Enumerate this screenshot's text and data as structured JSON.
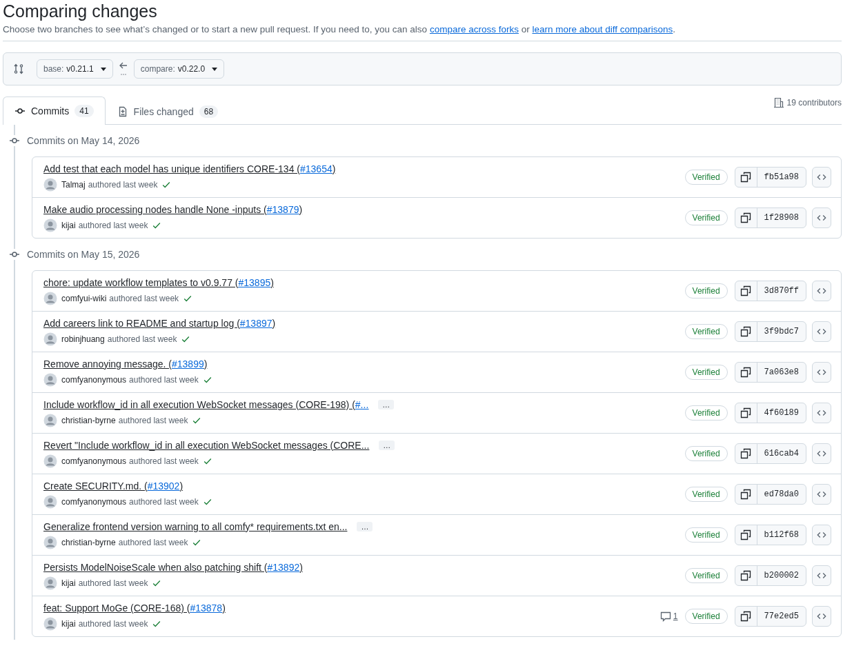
{
  "header": {
    "title": "Comparing changes",
    "description": {
      "text": "Choose two branches to see what’s changed or to start a new pull request. If you need to, you can also ",
      "link1": "compare across forks",
      "middle": " or ",
      "link2": "learn more about diff comparisons",
      "end": "."
    }
  },
  "compare": {
    "base": {
      "label": "base:",
      "value": "v0.21.1"
    },
    "head": {
      "label": "compare:",
      "value": "v0.22.0"
    }
  },
  "tabs": [
    {
      "label": "Commits",
      "count": "41",
      "selected": true
    },
    {
      "label": "Files changed",
      "count": "68",
      "selected": false
    }
  ],
  "contributors": "19 contributors",
  "groups": [
    {
      "heading": "Commits on May 14, 2026",
      "commits": [
        {
          "title": "Add test that each model has unique identifiers CORE-134 (",
          "pr": "#13654",
          "title_end": ")",
          "author": "Talmaj",
          "meta": "authored last week",
          "badge": "Verified",
          "sha": "fb51a98"
        },
        {
          "title": "Make audio processing nodes handle None -inputs (",
          "pr": "#13879",
          "title_end": ")",
          "author": "kijai",
          "meta": "authored last week",
          "badge": "Verified",
          "sha": "1f28908"
        }
      ]
    },
    {
      "heading": "Commits on May 15, 2026",
      "commits": [
        {
          "title": "chore: update workflow templates to v0.9.77 (",
          "pr": "#13895",
          "title_end": ")",
          "author": "comfyui-wiki",
          "meta": "authored last week",
          "badge": "Verified",
          "sha": "3d870ff"
        },
        {
          "title": "Add careers link to README and startup log (",
          "pr": "#13897",
          "title_end": ")",
          "author": "robinjhuang",
          "meta": "authored last week",
          "badge": "Verified",
          "sha": "3f9bdc7"
        },
        {
          "title": "Remove annoying message. (",
          "pr": "#13899",
          "title_end": ")",
          "author": "comfyanonymous",
          "meta": "authored last week",
          "badge": "Verified",
          "sha": "7a063e8"
        },
        {
          "title": "Include workflow_id in all execution WebSocket messages (CORE-198) (",
          "pr": "#...",
          "more": "…",
          "author": "christian-byrne",
          "meta": "authored last week",
          "badge": "Verified",
          "sha": "4f60189"
        },
        {
          "title": "Revert \"Include workflow_id in all execution WebSocket messages (CORE...",
          "more": "…",
          "author": "comfyanonymous",
          "meta": "authored last week",
          "badge": "Verified",
          "sha": "616cab4"
        },
        {
          "title": "Create SECURITY.md. (",
          "pr": "#13902",
          "title_end": ")",
          "author": "comfyanonymous",
          "meta": "authored last week",
          "badge": "Verified",
          "sha": "ed78da0"
        },
        {
          "title": "Generalize frontend version warning to all comfy* requirements.txt en...",
          "more": "…",
          "author": "christian-byrne",
          "meta": "authored last week",
          "badge": "Verified",
          "sha": "b112f68"
        },
        {
          "title": "Persists ModelNoiseScale when also patching shift (",
          "pr": "#13892",
          "title_end": ")",
          "author": "kijai",
          "meta": "authored last week",
          "badge": "Verified",
          "sha": "b200002"
        },
        {
          "title": "feat: Support MoGe (CORE-168) (",
          "pr": "#13878",
          "title_end": ")",
          "author": "kijai",
          "meta": "authored last week",
          "comments": "1",
          "badge": "Verified",
          "sha": "77e2ed5"
        }
      ]
    }
  ]
}
